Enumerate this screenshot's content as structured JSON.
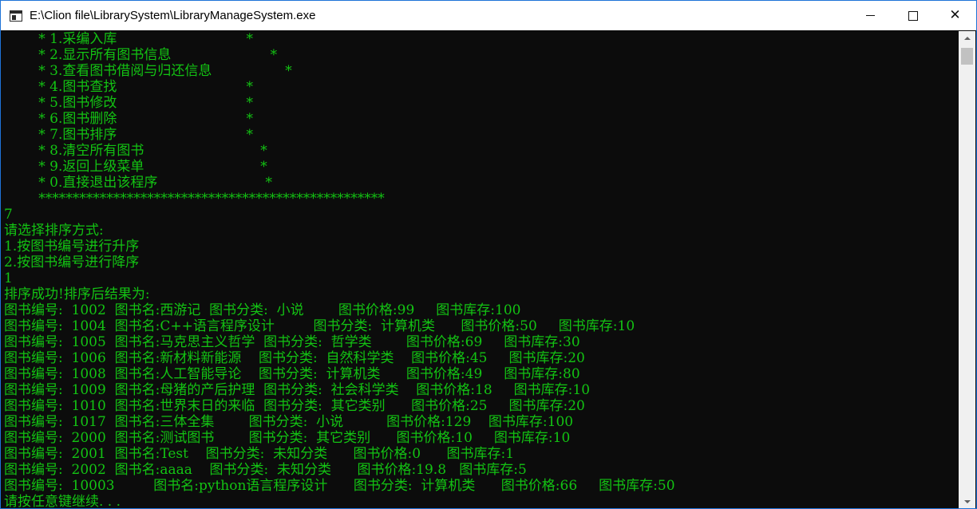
{
  "window": {
    "title": "E:\\Clion file\\LibrarySystem\\LibraryManageSystem.exe",
    "minimize_label": "",
    "close_label": "✕"
  },
  "console": {
    "lines": [
      "        * 1.采编入库                              *",
      "        * 2.显示所有图书信息                       *",
      "        * 3.查看图书借阅与归还信息                 *",
      "        * 4.图书查找                              *",
      "        * 5.图书修改                              *",
      "        * 6.图书删除                              *",
      "        * 7.图书排序                              *",
      "        * 8.清空所有图书                           *",
      "        * 9.返回上级菜单                           *",
      "        * 0.直接退出该程序                         *",
      "        ***************************************************",
      "7",
      "请选择排序方式:",
      "1.按图书编号进行升序",
      "2.按图书编号进行降序",
      "1",
      "排序成功!排序后结果为:",
      "图书编号:  1002  图书名:西游记  图书分类:  小说        图书价格:99     图书库存:100",
      "图书编号:  1004  图书名:C++语言程序设计         图书分类:  计算机类      图书价格:50     图书库存:10",
      "图书编号:  1005  图书名:马克思主义哲学  图书分类:  哲学类        图书价格:69     图书库存:30",
      "图书编号:  1006  图书名:新材料新能源    图书分类:  自然科学类    图书价格:45     图书库存:20",
      "图书编号:  1008  图书名:人工智能导论    图书分类:  计算机类      图书价格:49     图书库存:80",
      "图书编号:  1009  图书名:母猪的产后护理  图书分类:  社会科学类    图书价格:18     图书库存:10",
      "图书编号:  1010  图书名:世界末日的来临  图书分类:  其它类别      图书价格:25     图书库存:20",
      "图书编号:  1017  图书名:三体全集        图书分类:  小说          图书价格:129    图书库存:100",
      "图书编号:  2000  图书名:测试图书        图书分类:  其它类别      图书价格:10     图书库存:10",
      "图书编号:  2001  图书名:Test    图书分类:  未知分类      图书价格:0      图书库存:1",
      "图书编号:  2002  图书名:aaaa    图书分类:  未知分类      图书价格:19.8   图书库存:5",
      "图书编号:  10003         图书名:python语言程序设计      图书分类:  计算机类      图书价格:66     图书库存:50",
      "请按任意键继续. . ."
    ]
  },
  "colors": {
    "console_bg": "#0c0c0c",
    "console_text": "#13c313",
    "titlebar_bg": "#ffffff",
    "window_border": "#1e73d8"
  },
  "icons": {
    "app": "console-app-icon",
    "minimize": "minimize-icon",
    "maximize": "maximize-icon",
    "close": "close-icon"
  }
}
